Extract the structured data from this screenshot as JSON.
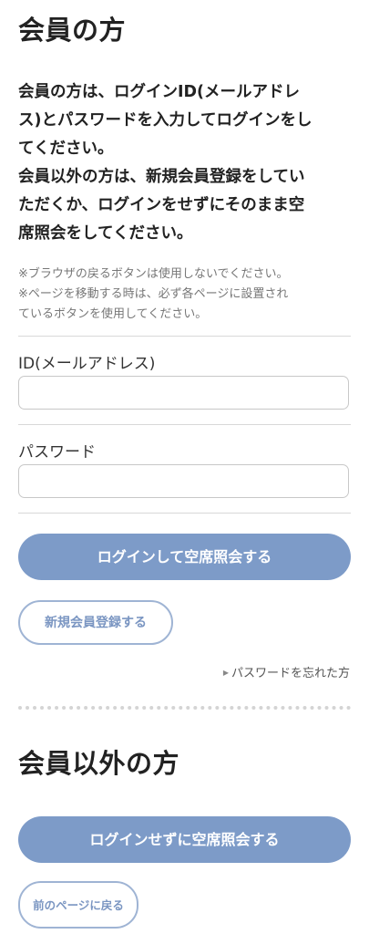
{
  "member_section": {
    "title": "会員の方",
    "intro_lines": [
      "会員の方は、ログインID(メールアドレ",
      "ス)とパスワードを入力してログインをし",
      "てください。",
      "会員以外の方は、新規会員登録をしてい",
      "ただくか、ログインをせずにそのまま空",
      "席照会をしてください。"
    ],
    "notes_lines": [
      "※ブラウザの戻るボタンは使用しないでください。",
      "※ページを移動する時は、必ず各ページに設置され",
      "ているボタンを使用してください。"
    ],
    "id_field": {
      "label": "ID(メールアドレス)",
      "value": "",
      "placeholder": ""
    },
    "password_field": {
      "label": "パスワード",
      "value": "",
      "placeholder": ""
    },
    "login_button_label": "ログインして空席照会する",
    "register_button_label": "新規会員登録する",
    "forgot_password": {
      "arrow_icon": "triangle-right-icon",
      "label": "パスワードを忘れた方"
    }
  },
  "nonmember_section": {
    "title": "会員以外の方",
    "guest_button_label": "ログインせずに空席照会する",
    "back_button_label": "前のページに戻る"
  },
  "colors": {
    "primary_button": "#7d9bc8",
    "outline_border": "#9fb4d4",
    "outline_text": "#7b96c2",
    "text": "#222222",
    "note_text": "#777777",
    "divider": "#d8d8d8"
  }
}
